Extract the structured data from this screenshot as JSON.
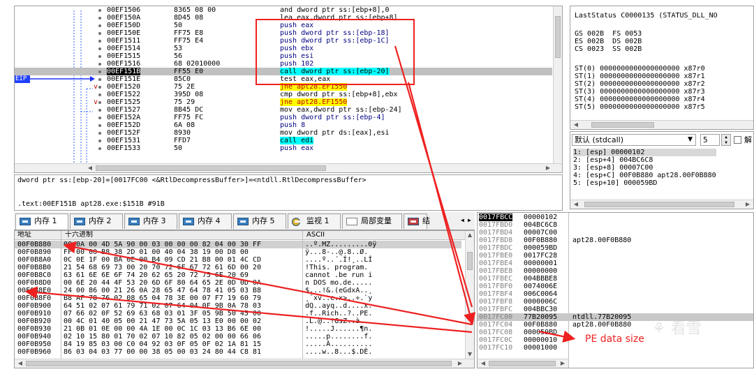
{
  "disasm": {
    "rows": [
      {
        "addr": "00EF1506",
        "bytes": "8365 08 00",
        "instr": "and dword ptr ss:[ebp+8],0",
        "mark": ""
      },
      {
        "addr": "00EF150A",
        "bytes": "8D45 08",
        "instr": "lea eax,dword ptr ss:[ebp+8]",
        "mark": ""
      },
      {
        "addr": "00EF150D",
        "bytes": "50",
        "instr": "push eax",
        "mark": ""
      },
      {
        "addr": "00EF150E",
        "bytes": "FF75 E8",
        "instr": "push dword ptr ss:[ebp-18]",
        "mark": ""
      },
      {
        "addr": "00EF1511",
        "bytes": "FF75 E4",
        "instr": "push dword ptr ss:[ebp-1C]",
        "mark": ""
      },
      {
        "addr": "00EF1514",
        "bytes": "53",
        "instr": "push ebx",
        "mark": ""
      },
      {
        "addr": "00EF1515",
        "bytes": "56",
        "instr": "push esi",
        "mark": ""
      },
      {
        "addr": "00EF1516",
        "bytes": "68 02010000",
        "instr": "push 102",
        "mark": ""
      },
      {
        "addr": "00EF151B",
        "bytes": "FF55 E0",
        "instr": "call dword ptr ss:[ebp-20]",
        "mark": ""
      },
      {
        "addr": "00EF151E",
        "bytes": "85C0",
        "instr": "test eax,eax",
        "mark": ""
      },
      {
        "addr": "00EF1520",
        "bytes": "75 2E",
        "instr": "jne apt28.EF1550",
        "mark": "v"
      },
      {
        "addr": "00EF1522",
        "bytes": "395D 08",
        "instr": "cmp dword ptr ss:[ebp+8],ebx",
        "mark": ""
      },
      {
        "addr": "00EF1525",
        "bytes": "75 29",
        "instr": "jne apt28.EF1550",
        "mark": "v"
      },
      {
        "addr": "00EF1527",
        "bytes": "8B45 DC",
        "instr": "mov eax,dword ptr ss:[ebp-24]",
        "mark": ""
      },
      {
        "addr": "00EF152A",
        "bytes": "FF75 FC",
        "instr": "push dword ptr ss:[ebp-4]",
        "mark": ""
      },
      {
        "addr": "00EF152D",
        "bytes": "6A 08",
        "instr": "push 8",
        "mark": ""
      },
      {
        "addr": "00EF152F",
        "bytes": "8930",
        "instr": "mov dword ptr ds:[eax],esi",
        "mark": ""
      },
      {
        "addr": "00EF1531",
        "bytes": "FFD7",
        "instr": "call edi",
        "mark": ""
      },
      {
        "addr": "00EF1533",
        "bytes": "50",
        "instr": "push eax",
        "mark": ""
      }
    ],
    "eip_label": "EIP",
    "selected_index": 8
  },
  "info": {
    "line1": "dword ptr ss:[ebp-20]=[0017FC00 <&RtlDecompressBuffer>]=<ntdll.RtlDecompressBuffer>",
    "line2": ".text:00EF151B apt28.exe:$151B #91B"
  },
  "registers": {
    "last_status": "LastStatus C0000135 (STATUS_DLL_NO",
    "segs": [
      "GS 002B  FS 0053",
      "ES 002B  DS 002B",
      "CS 0023  SS 002B"
    ],
    "fpu": [
      "ST(0) 0000000000000000000 x87r0",
      "ST(1) 0000000000000000000 x87r1",
      "ST(2) 0000000000000000000 x87r2",
      "ST(3) 0000000000000000000 x87r3",
      "ST(4) 0000000000000000000 x87r4",
      "ST(5) 0000000000000000000 x87r5"
    ]
  },
  "callconv": {
    "select": "默认 (stdcall)",
    "count": "5",
    "unlock_label": "解",
    "args": [
      "1: [esp] 00000102",
      "2: [esp+4] 004BC6C8",
      "3: [esp+8] 00007C00",
      "4: [esp+C] 00F0B880 apt28.00F0B880",
      "5: [esp+10] 000059BD"
    ]
  },
  "tabs": [
    {
      "label": "内存 1",
      "active": true
    },
    {
      "label": "内存 2",
      "active": false
    },
    {
      "label": "内存 3",
      "active": false
    },
    {
      "label": "内存 4",
      "active": false
    },
    {
      "label": "内存 5",
      "active": false
    },
    {
      "label": "监视 1",
      "active": false
    },
    {
      "label": "局部变量",
      "active": false
    },
    {
      "label": "结",
      "active": false
    }
  ],
  "dump": {
    "col_addr": "地址",
    "col_hex": "十六进制",
    "col_ascii": "ASCII",
    "rows": [
      {
        "addr": "00F0B880",
        "hex": "00 0A 00 4D 5A 90 00 03 00 00 00 82 04 00 30 FF",
        "ascii": "..º.MZ.........0ÿ"
      },
      {
        "addr": "00F0B890",
        "hex": "FF 00 00 B8 38 2D 01 00 40 04 38 19 00 D8 00",
        "ascii": "ÿ...8-..@.8..Ø."
      },
      {
        "addr": "00F0B8A0",
        "hex": "0C 0E 1F 00 BA 0E 00 B4 09 CD 21 B8 00 01 4C CD",
        "ascii": "....º..´.Í!¸..LÍ"
      },
      {
        "addr": "00F0B8B0",
        "hex": "21 54 68 69 73 00 20 70 72 6F 67 72 61 6D 00 20",
        "ascii": "!This. program. "
      },
      {
        "addr": "00F0B8C0",
        "hex": "63 61 6E 6E 6F 74 20 62 65 20 72 75 6E 20 69",
        "ascii": "cannot .be run i"
      },
      {
        "addr": "00F0B8D0",
        "hex": "00 6E 20 44 4F 53 20 6D 6F 80 64 65 2E 0D 0D 0A",
        "ascii": "n DOS mo.de....."
      },
      {
        "addr": "00F0B8E0",
        "hex": "24 00 86 00 21 26 0A 28 65 47 64 78 41 05 03 B8",
        "ascii": "$...!&.(eGdxA..¸"
      },
      {
        "addr": "00F0B8F0",
        "hex": "B8 AF 78 76 02 08 65 04 78 3E 00 07 F7 19 60 79",
        "ascii": "¸¯xv..e.x>..÷.`y"
      },
      {
        "addr": "00F0B900",
        "hex": "64 51 02 07 61 79 71 02 07 64 04 0F 9B 0A 78 03",
        "ascii": "dQ..ayq..d....x."
      },
      {
        "addr": "00F0B910",
        "hex": "07 66 02 0F 52 69 63 68 03 01 3F 05 9B 50 45 00",
        "ascii": ".f..Rich..?..PE."
      },
      {
        "addr": "00F0B920",
        "hex": "00 4C 01 40 05 00 21 47 73 5A 05 13 E0 00 00 02",
        "ascii": ".L.@..!GsZ..à..."
      },
      {
        "addr": "00F0B930",
        "hex": "21 0B 01 0E 00 00 4A 1E 00 0C 1C 03 13 B6 6E 00",
        "ascii": "!.....J......¶n."
      },
      {
        "addr": "00F0B940",
        "hex": "02 10 15 80 01 70 02 07 10 82 05 02 00 00 66 06",
        "ascii": ".....p........f."
      },
      {
        "addr": "00F0B950",
        "hex": "84 19 85 03 00 C0 04 92 03 0F 05 0F 02 1A 81 15",
        "ascii": ".....À.........."
      },
      {
        "addr": "00F0B960",
        "hex": "86 03 04 03 77 00 00 38 05 00 03 24 80 44 C8 81",
        "ascii": "....w..8...$.DÈ."
      }
    ]
  },
  "stack": {
    "rows": [
      {
        "addr": "0017FBCC",
        "val": "00000102",
        "comment": "",
        "top": true
      },
      {
        "addr": "0017FBD0",
        "val": "004BC6C8",
        "comment": ""
      },
      {
        "addr": "0017FBD4",
        "val": "00007C00",
        "comment": ""
      },
      {
        "addr": "0017FBD8",
        "val": "00F0B880",
        "comment": "apt28.00F0B880"
      },
      {
        "addr": "0017FBDC",
        "val": "000059BD",
        "comment": ""
      },
      {
        "addr": "0017FBE0",
        "val": "0017FC28",
        "comment": ""
      },
      {
        "addr": "0017FBE4",
        "val": "00000001",
        "comment": ""
      },
      {
        "addr": "0017FBE8",
        "val": "00000000",
        "comment": ""
      },
      {
        "addr": "0017FBEC",
        "val": "004BBBE8",
        "comment": ""
      },
      {
        "addr": "0017FBF0",
        "val": "0074006E",
        "comment": ""
      },
      {
        "addr": "0017FBF4",
        "val": "006C0064",
        "comment": ""
      },
      {
        "addr": "0017FBF8",
        "val": "0000006C",
        "comment": ""
      },
      {
        "addr": "0017FBFC",
        "val": "004BBC30",
        "comment": ""
      },
      {
        "addr": "0017FC00",
        "val": "77B20095",
        "comment": "ntdll.77B20095",
        "hl": true
      },
      {
        "addr": "0017FC04",
        "val": "00F0B880",
        "comment": "apt28.00F0B880"
      },
      {
        "addr": "0017FC08",
        "val": "000059BD",
        "comment": ""
      },
      {
        "addr": "0017FC0C",
        "val": "00000010",
        "comment": ""
      },
      {
        "addr": "0017FC10",
        "val": "00001000",
        "comment": ""
      }
    ]
  },
  "annotation": {
    "label": "PE data size"
  }
}
